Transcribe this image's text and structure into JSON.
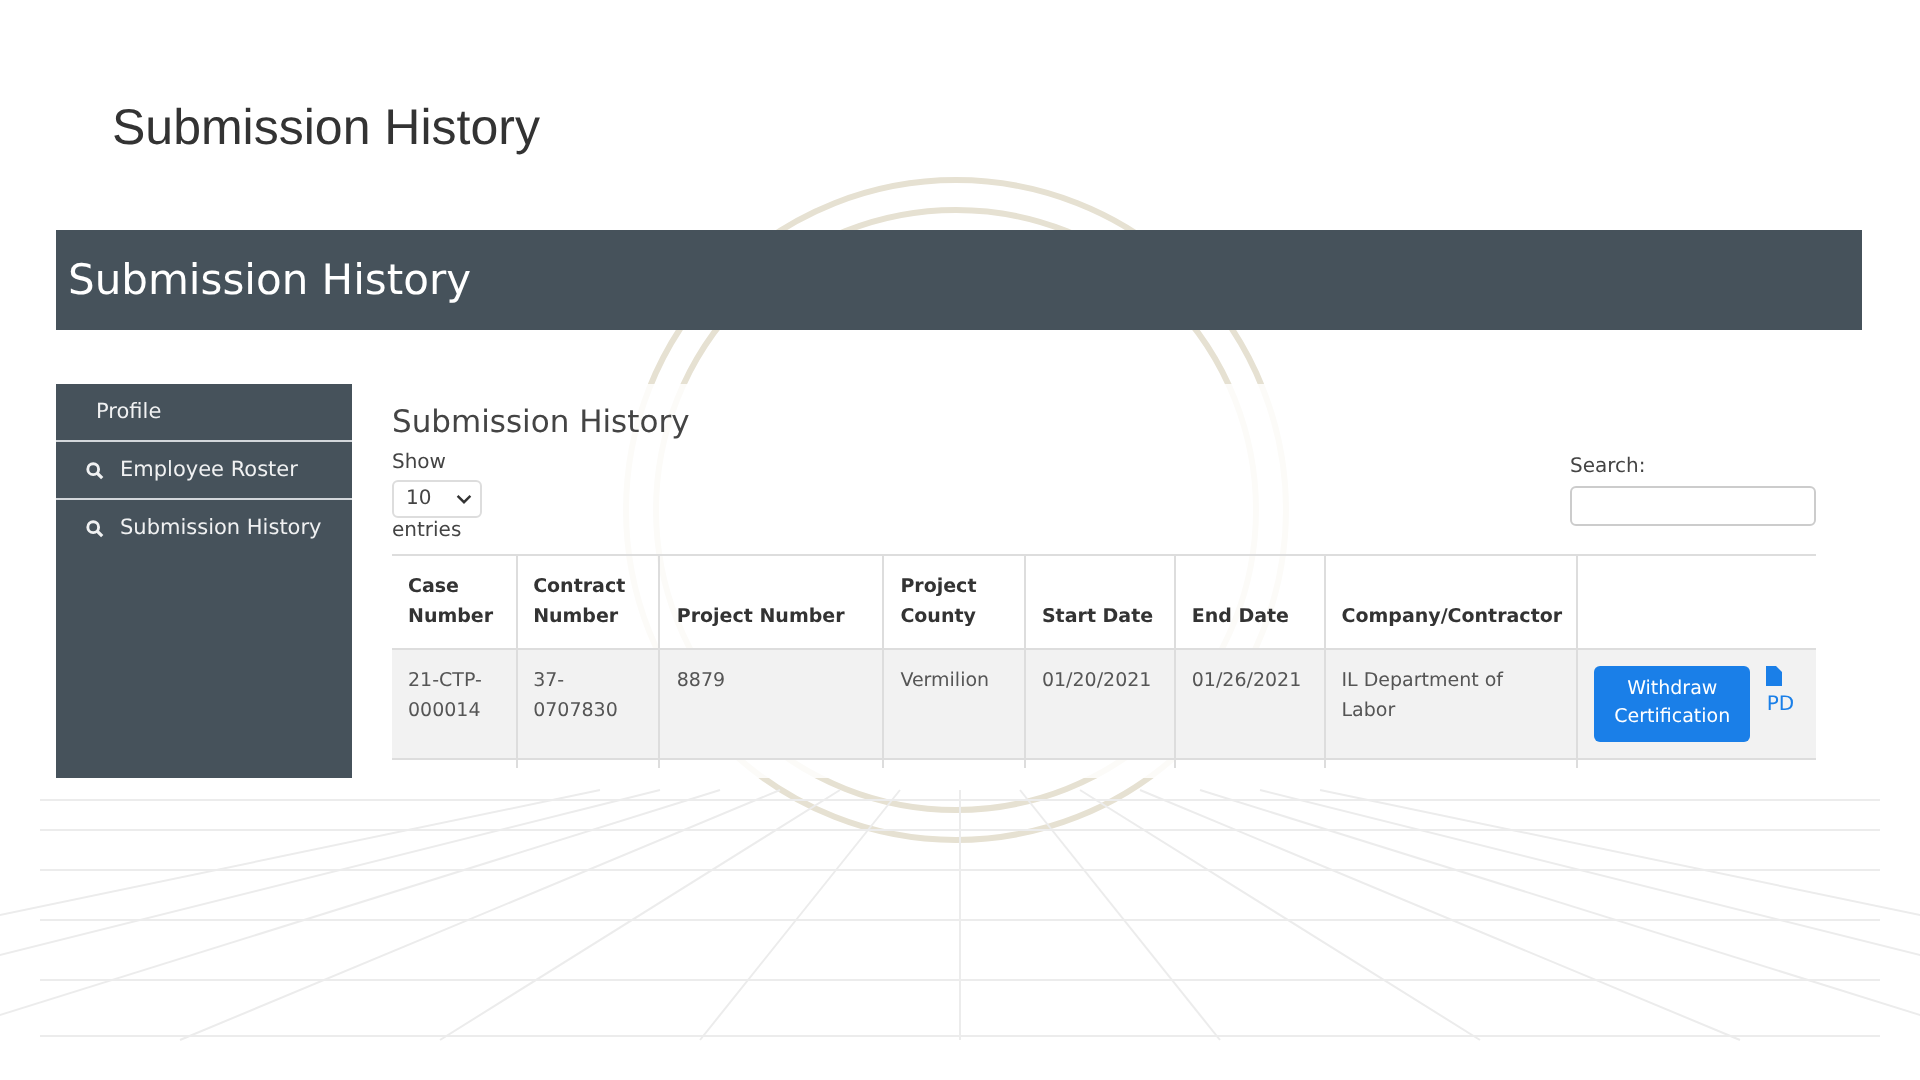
{
  "slide_title": "Submission History",
  "banner": {
    "title": "Submission History"
  },
  "sidebar": {
    "items": [
      {
        "label": "Profile",
        "icon": false
      },
      {
        "label": "Employee Roster",
        "icon": true
      },
      {
        "label": "Submission History",
        "icon": true
      }
    ]
  },
  "main": {
    "heading": "Submission History",
    "show_label": "Show",
    "page_size": "10",
    "entries_label": "entries",
    "search_label": "Search:"
  },
  "table": {
    "columns": [
      "Case Number",
      "Contract Number",
      "Project Number",
      "Project County",
      "Start Date",
      "End Date",
      "Company/Contractor"
    ],
    "rows": [
      {
        "cells": [
          "21-CTP-000014",
          "37-0707830",
          "8879",
          "Vermilion",
          "01/20/2021",
          "01/26/2021",
          "IL Department of Labor"
        ],
        "action": "Withdraw Certification",
        "file_link": "PD"
      }
    ]
  }
}
